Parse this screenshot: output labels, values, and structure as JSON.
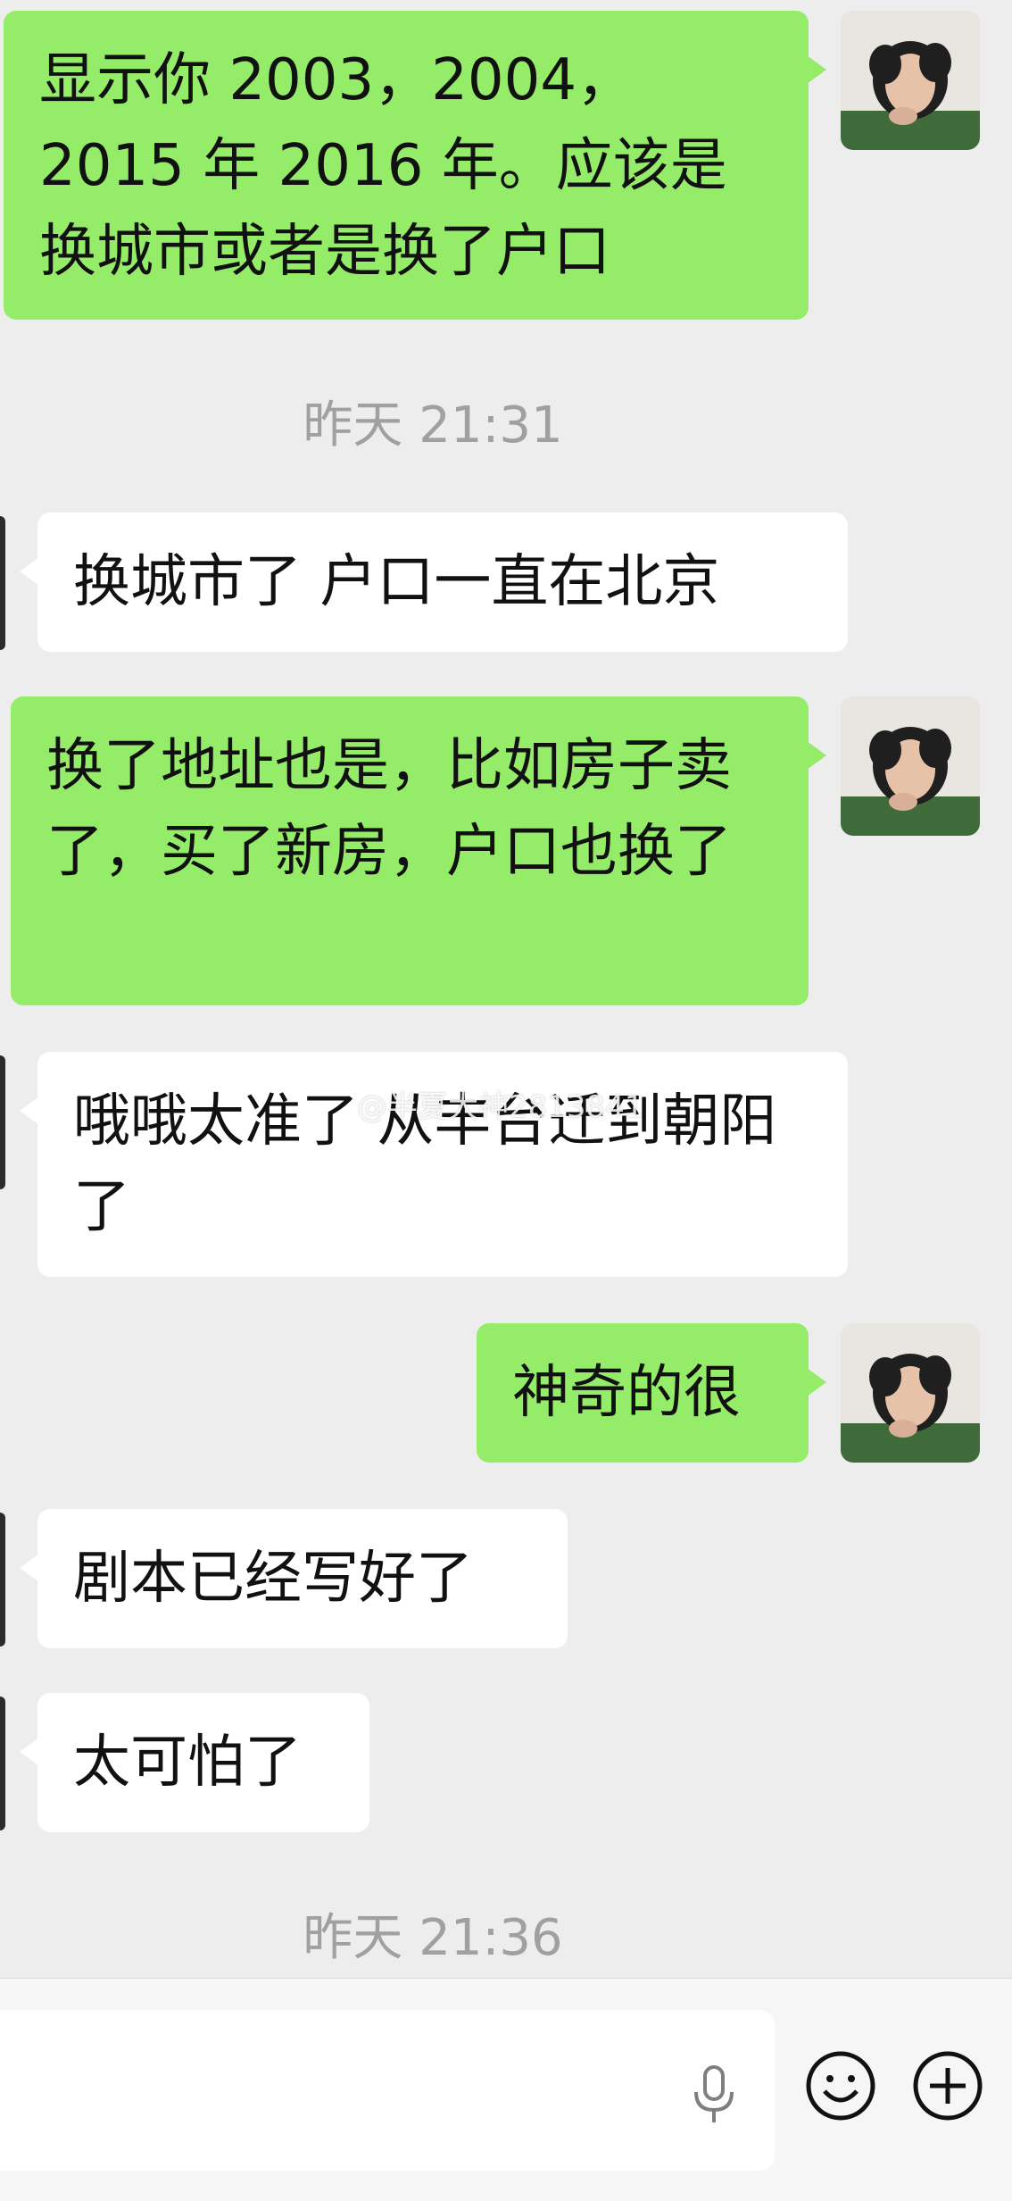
{
  "messages": [
    {
      "side": "out",
      "text": "显示你 2003，2004，2015 年 2016 年。应该是换城市或者是换了户口"
    },
    {
      "side": "in",
      "text": "换城市了 户口一直在北京"
    },
    {
      "side": "out",
      "text": "换了地址也是，比如房子卖了，买了新房，户口也换了"
    },
    {
      "side": "in",
      "text": "哦哦太准了 从丰台迁到朝阳了"
    },
    {
      "side": "out",
      "text": "神奇的很"
    },
    {
      "side": "in",
      "text": "剧本已经写好了"
    },
    {
      "side": "in",
      "text": "太可怕了"
    }
  ],
  "timestamps": {
    "t1": "昨天 21:31",
    "t2": "昨天 21:36"
  },
  "watermark": "@半夏大神2813841",
  "input": {
    "value": "",
    "placeholder": ""
  },
  "colors": {
    "outgoing_bubble": "#95ec69",
    "incoming_bubble": "#ffffff",
    "background": "#ededed",
    "timestamp_text": "#a0a0a0"
  },
  "icons": {
    "mic": "microphone-icon",
    "emoji": "smiley-face-icon",
    "more": "plus-circle-icon"
  }
}
